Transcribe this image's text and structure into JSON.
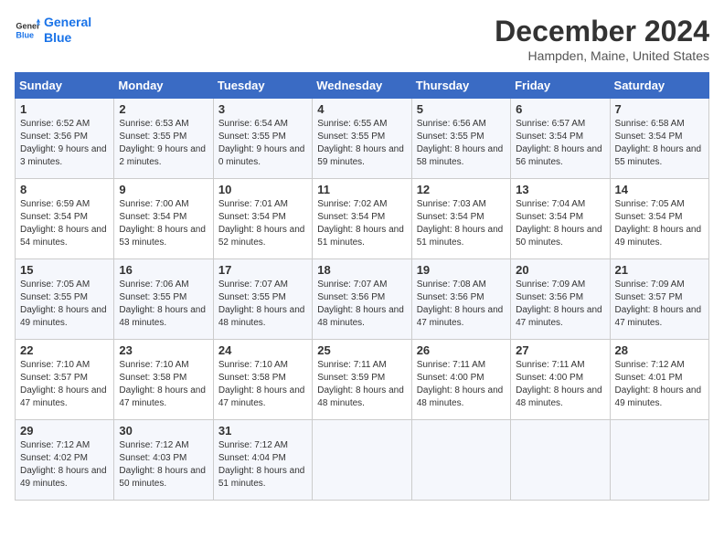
{
  "header": {
    "logo_line1": "General",
    "logo_line2": "Blue",
    "month_title": "December 2024",
    "location": "Hampden, Maine, United States"
  },
  "days_of_week": [
    "Sunday",
    "Monday",
    "Tuesday",
    "Wednesday",
    "Thursday",
    "Friday",
    "Saturday"
  ],
  "weeks": [
    [
      {
        "day": "1",
        "sunrise": "6:52 AM",
        "sunset": "3:56 PM",
        "daylight": "9 hours and 3 minutes."
      },
      {
        "day": "2",
        "sunrise": "6:53 AM",
        "sunset": "3:55 PM",
        "daylight": "9 hours and 2 minutes."
      },
      {
        "day": "3",
        "sunrise": "6:54 AM",
        "sunset": "3:55 PM",
        "daylight": "9 hours and 0 minutes."
      },
      {
        "day": "4",
        "sunrise": "6:55 AM",
        "sunset": "3:55 PM",
        "daylight": "8 hours and 59 minutes."
      },
      {
        "day": "5",
        "sunrise": "6:56 AM",
        "sunset": "3:55 PM",
        "daylight": "8 hours and 58 minutes."
      },
      {
        "day": "6",
        "sunrise": "6:57 AM",
        "sunset": "3:54 PM",
        "daylight": "8 hours and 56 minutes."
      },
      {
        "day": "7",
        "sunrise": "6:58 AM",
        "sunset": "3:54 PM",
        "daylight": "8 hours and 55 minutes."
      }
    ],
    [
      {
        "day": "8",
        "sunrise": "6:59 AM",
        "sunset": "3:54 PM",
        "daylight": "8 hours and 54 minutes."
      },
      {
        "day": "9",
        "sunrise": "7:00 AM",
        "sunset": "3:54 PM",
        "daylight": "8 hours and 53 minutes."
      },
      {
        "day": "10",
        "sunrise": "7:01 AM",
        "sunset": "3:54 PM",
        "daylight": "8 hours and 52 minutes."
      },
      {
        "day": "11",
        "sunrise": "7:02 AM",
        "sunset": "3:54 PM",
        "daylight": "8 hours and 51 minutes."
      },
      {
        "day": "12",
        "sunrise": "7:03 AM",
        "sunset": "3:54 PM",
        "daylight": "8 hours and 51 minutes."
      },
      {
        "day": "13",
        "sunrise": "7:04 AM",
        "sunset": "3:54 PM",
        "daylight": "8 hours and 50 minutes."
      },
      {
        "day": "14",
        "sunrise": "7:05 AM",
        "sunset": "3:54 PM",
        "daylight": "8 hours and 49 minutes."
      }
    ],
    [
      {
        "day": "15",
        "sunrise": "7:05 AM",
        "sunset": "3:55 PM",
        "daylight": "8 hours and 49 minutes."
      },
      {
        "day": "16",
        "sunrise": "7:06 AM",
        "sunset": "3:55 PM",
        "daylight": "8 hours and 48 minutes."
      },
      {
        "day": "17",
        "sunrise": "7:07 AM",
        "sunset": "3:55 PM",
        "daylight": "8 hours and 48 minutes."
      },
      {
        "day": "18",
        "sunrise": "7:07 AM",
        "sunset": "3:56 PM",
        "daylight": "8 hours and 48 minutes."
      },
      {
        "day": "19",
        "sunrise": "7:08 AM",
        "sunset": "3:56 PM",
        "daylight": "8 hours and 47 minutes."
      },
      {
        "day": "20",
        "sunrise": "7:09 AM",
        "sunset": "3:56 PM",
        "daylight": "8 hours and 47 minutes."
      },
      {
        "day": "21",
        "sunrise": "7:09 AM",
        "sunset": "3:57 PM",
        "daylight": "8 hours and 47 minutes."
      }
    ],
    [
      {
        "day": "22",
        "sunrise": "7:10 AM",
        "sunset": "3:57 PM",
        "daylight": "8 hours and 47 minutes."
      },
      {
        "day": "23",
        "sunrise": "7:10 AM",
        "sunset": "3:58 PM",
        "daylight": "8 hours and 47 minutes."
      },
      {
        "day": "24",
        "sunrise": "7:10 AM",
        "sunset": "3:58 PM",
        "daylight": "8 hours and 47 minutes."
      },
      {
        "day": "25",
        "sunrise": "7:11 AM",
        "sunset": "3:59 PM",
        "daylight": "8 hours and 48 minutes."
      },
      {
        "day": "26",
        "sunrise": "7:11 AM",
        "sunset": "4:00 PM",
        "daylight": "8 hours and 48 minutes."
      },
      {
        "day": "27",
        "sunrise": "7:11 AM",
        "sunset": "4:00 PM",
        "daylight": "8 hours and 48 minutes."
      },
      {
        "day": "28",
        "sunrise": "7:12 AM",
        "sunset": "4:01 PM",
        "daylight": "8 hours and 49 minutes."
      }
    ],
    [
      {
        "day": "29",
        "sunrise": "7:12 AM",
        "sunset": "4:02 PM",
        "daylight": "8 hours and 49 minutes."
      },
      {
        "day": "30",
        "sunrise": "7:12 AM",
        "sunset": "4:03 PM",
        "daylight": "8 hours and 50 minutes."
      },
      {
        "day": "31",
        "sunrise": "7:12 AM",
        "sunset": "4:04 PM",
        "daylight": "8 hours and 51 minutes."
      },
      null,
      null,
      null,
      null
    ]
  ]
}
